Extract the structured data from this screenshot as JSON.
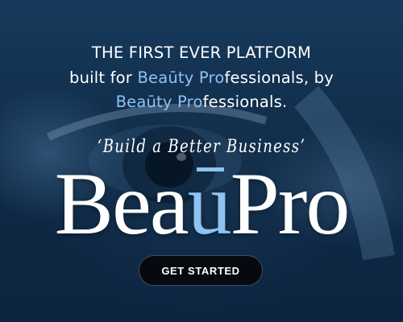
{
  "hero": {
    "line1": "THE FIRST EVER PLATFORM",
    "line2_prefix": "built for ",
    "line2_brand_a": "Beaūty",
    "line2_space": " ",
    "line2_brand_b": "Pro",
    "line2_suffix": "fessionals, by",
    "line3_brand_a": "Beaūty",
    "line3_space": " ",
    "line3_brand_b": "Pro",
    "line3_suffix": "fessionals.",
    "tagline": "‘Build a Better Business’",
    "logo_part1": "Bea",
    "logo_part2": "u",
    "logo_part3": "Pro",
    "cta_label": "GET STARTED"
  },
  "colors": {
    "background": "#123455",
    "accent": "#8ec3f1",
    "text": "#ffffff",
    "button": "#06090e"
  }
}
